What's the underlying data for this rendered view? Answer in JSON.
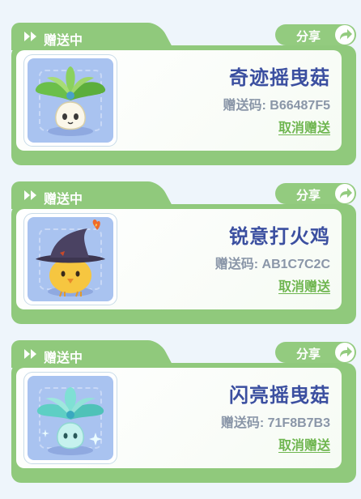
{
  "cards": [
    {
      "status_label": "赠送中",
      "share_label": "分享",
      "item_name": "奇迹摇曳菇",
      "gift_code": "赠送码: B66487F5",
      "cancel_label": "取消赠送",
      "icon": "leafy-mushroom-icon"
    },
    {
      "status_label": "赠送中",
      "share_label": "分享",
      "item_name": "锐意打火鸡",
      "gift_code": "赠送码: AB1C7C2C",
      "cancel_label": "取消赠送",
      "icon": "witch-hat-chick-icon"
    },
    {
      "status_label": "赠送中",
      "share_label": "分享",
      "item_name": "闪亮摇曳菇",
      "gift_code": "赠送码: 71F8B7B3",
      "cancel_label": "取消赠送",
      "icon": "shiny-mushroom-icon"
    }
  ],
  "colors": {
    "card_green": "#90c97c",
    "name_blue": "#3b4fa0",
    "code_gray": "#8a96a8",
    "cancel_green": "#6fb650",
    "thumb_blue": "#a9c3f0"
  }
}
